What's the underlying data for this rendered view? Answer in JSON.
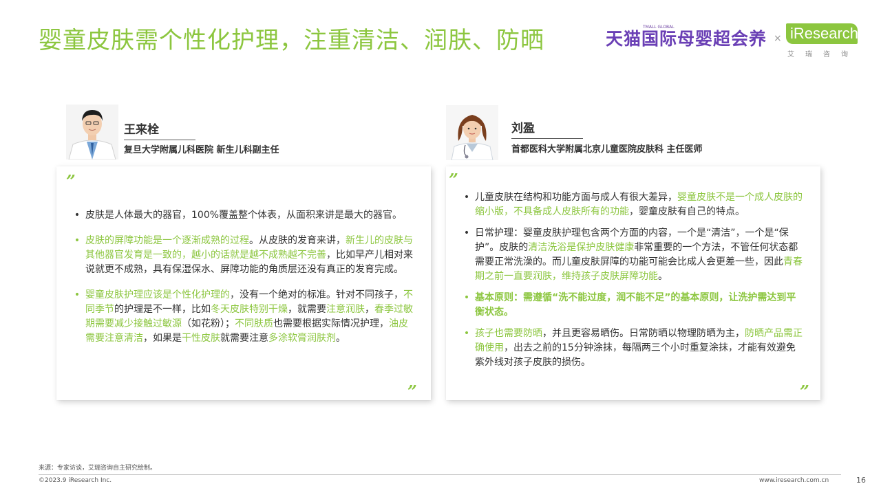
{
  "title": "婴童皮肤需个性化护理，注重清洁、润肤、防晒",
  "logos": {
    "tmall_small": "TMALL GLOBAL",
    "tmall_name": "天猫国际母婴超会养",
    "times": "×",
    "iresearch": "iResearch",
    "iresearch_cn": "艾瑞咨询"
  },
  "experts": [
    {
      "name": "王来栓",
      "title": "复旦大学附属儿科医院  新生儿科副主任"
    },
    {
      "name": "刘盈",
      "title": "首都医科大学附属北京儿童医院皮肤科 主任医师"
    }
  ],
  "quote_open": "”",
  "quote_close": "”",
  "bullet_symbol": "•",
  "left_bullets": {
    "b1": "皮肤是人体最大的器官，100%覆盖整个体表，从面积来讲是最大的器官。",
    "b2": [
      "皮肤的屏障功能是一个逐渐成熟的过程",
      "。从皮肤的发育来讲，",
      "新生儿的皮肤与其他器官发育是一致的，越小的话就是越不成熟越不完善",
      "，比如早产儿相对来说就更不成熟，具有保湿保水、屏障功能的角质层还没有真正的发育完成。"
    ],
    "b3": [
      "婴童皮肤护理应该是个性化护理的",
      "，没有一个绝对的标准。针对不同孩子，",
      "不同季节",
      "的护理是不一样，比如",
      "冬天皮肤特别干燥",
      "，就需要",
      "注意润肤",
      "，",
      "春季过敏期需要减少接触过敏源",
      "（如花粉）；",
      "不同肤质",
      "也需要根据实际情况护理，",
      "油皮需要注意清洁",
      "，如果是",
      "干性皮肤",
      "就需要注意",
      "多涂软膏润肤剂",
      "。"
    ]
  },
  "right_bullets": {
    "b1": [
      "儿童皮肤在结构和功能方面与成人有很大差异，",
      "婴童皮肤不是一个成人皮肤的缩小版，不具备成人皮肤所有的功能",
      "，婴童皮肤有自己的特点。"
    ],
    "b2": [
      "日常护理：婴童皮肤护理包含两个方面的内容，一个是“清洁”，一个是“保护”。皮肤的",
      "清洁洗浴是保护皮肤健康",
      "非常重要的一个方法，不管任何状态都需要正常洗澡的。而儿童皮肤屏障的功能可能会比成人会更差一些，因此",
      "青春期之前一直要润肤，维持孩子皮肤屏障功能",
      "。"
    ],
    "b3": "基本原则：需遵循“洗不能过度，润不能不足”的基本原则，让洗护需达到平衡状态。",
    "b4": [
      "孩子也需要防晒",
      "，并且更容易晒伤。日常防晒以物理防晒为主，",
      "防晒产品需正确使用",
      "，出去之前的15分钟涂抹，每隔两三个小时重复涂抹，才能有效避免紫外线对孩子皮肤的损伤。"
    ]
  },
  "footer": {
    "source": "来源：专家访谈，艾瑞咨询自主研究绘制。",
    "copyright": "©2023.9 iResearch Inc.",
    "website": "www.iresearch.com.cn",
    "page": "16"
  },
  "colors": {
    "accent": "#8cc63f",
    "tmall": "#6a3fb5",
    "text": "#333333"
  }
}
